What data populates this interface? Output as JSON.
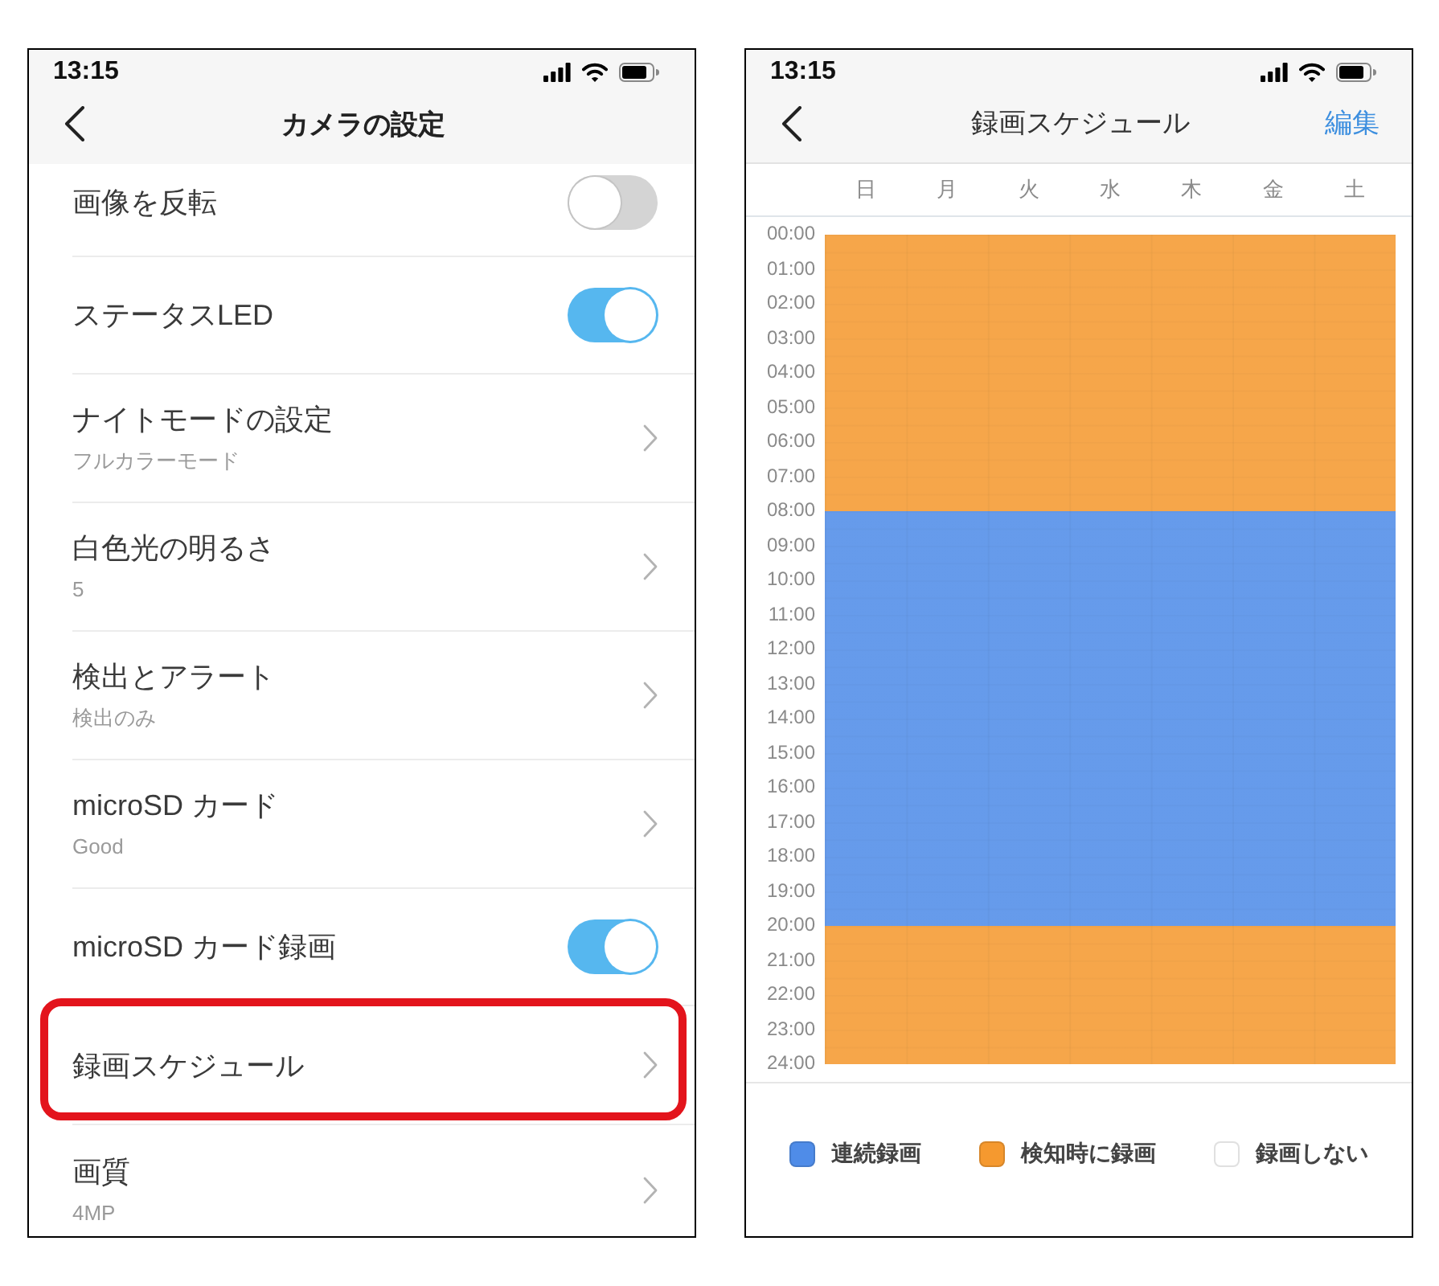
{
  "settings_screen": {
    "status_bar": {
      "time": "13:15"
    },
    "nav": {
      "title": "カメラの設定"
    },
    "items": [
      {
        "kind": "toggle",
        "title": "画像を反転",
        "on": false,
        "highlighted": false
      },
      {
        "kind": "toggle",
        "title": "ステータスLED",
        "on": true,
        "highlighted": false
      },
      {
        "kind": "link",
        "title": "ナイトモードの設定",
        "subtitle": "フルカラーモード",
        "highlighted": false
      },
      {
        "kind": "link",
        "title": "白色光の明るさ",
        "subtitle": "5",
        "highlighted": false
      },
      {
        "kind": "link",
        "title": "検出とアラート",
        "subtitle": "検出のみ",
        "highlighted": false
      },
      {
        "kind": "link",
        "title": "microSD カード",
        "subtitle": "Good",
        "highlighted": false
      },
      {
        "kind": "toggle",
        "title": "microSD カード録画",
        "on": true,
        "highlighted": false
      },
      {
        "kind": "link",
        "title": "録画スケジュール",
        "highlighted": true
      },
      {
        "kind": "link",
        "title": "画質",
        "subtitle": "4MP",
        "highlighted": false
      }
    ]
  },
  "schedule_screen": {
    "status_bar": {
      "time": "13:15"
    },
    "nav": {
      "title": "録画スケジュール",
      "action": "編集"
    },
    "days": [
      "日",
      "月",
      "火",
      "水",
      "木",
      "金",
      "土"
    ],
    "time_labels": [
      "00:00",
      "01:00",
      "02:00",
      "03:00",
      "04:00",
      "05:00",
      "06:00",
      "07:00",
      "08:00",
      "09:00",
      "10:00",
      "11:00",
      "12:00",
      "13:00",
      "14:00",
      "15:00",
      "16:00",
      "17:00",
      "18:00",
      "19:00",
      "20:00",
      "21:00",
      "22:00",
      "23:00",
      "24:00"
    ],
    "hour_slots": [
      {
        "kind": "motion"
      },
      {
        "kind": "motion"
      },
      {
        "kind": "motion"
      },
      {
        "kind": "motion"
      },
      {
        "kind": "motion"
      },
      {
        "kind": "motion"
      },
      {
        "kind": "motion"
      },
      {
        "kind": "motion"
      },
      {
        "kind": "continuous"
      },
      {
        "kind": "continuous"
      },
      {
        "kind": "continuous"
      },
      {
        "kind": "continuous"
      },
      {
        "kind": "continuous"
      },
      {
        "kind": "continuous"
      },
      {
        "kind": "continuous"
      },
      {
        "kind": "continuous"
      },
      {
        "kind": "continuous"
      },
      {
        "kind": "continuous"
      },
      {
        "kind": "continuous"
      },
      {
        "kind": "continuous"
      },
      {
        "kind": "motion"
      },
      {
        "kind": "motion"
      },
      {
        "kind": "motion"
      },
      {
        "kind": "motion"
      }
    ],
    "legend": [
      {
        "kind": "continuous",
        "label": "連続録画",
        "color": "#4f8ce8"
      },
      {
        "kind": "motion",
        "label": "検知時に録画",
        "color": "#f5992f"
      },
      {
        "kind": "off",
        "label": "録画しない",
        "color": "#ffffff"
      }
    ]
  }
}
